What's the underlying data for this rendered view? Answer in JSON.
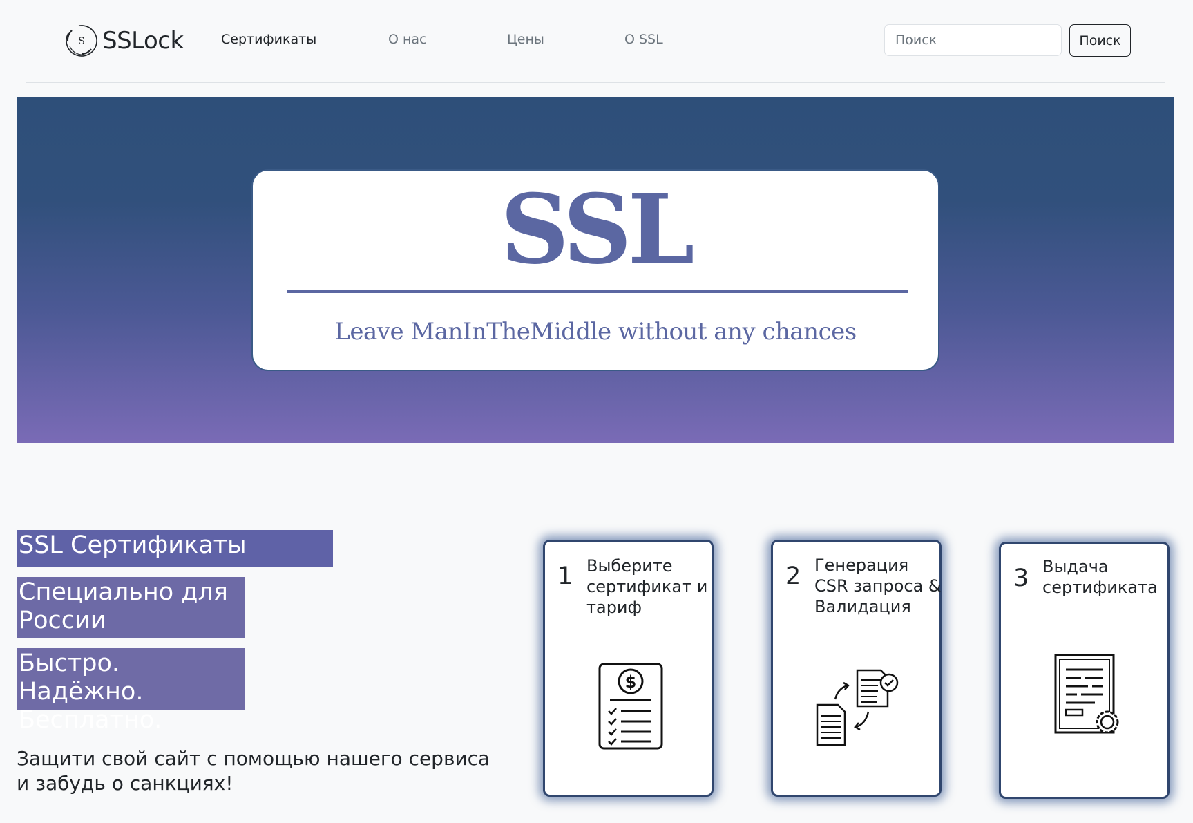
{
  "brand": {
    "logo_letter": "S",
    "name": "SSLock"
  },
  "nav": {
    "items": [
      {
        "label": "Сертификаты",
        "active": true
      },
      {
        "label": "О нас"
      },
      {
        "label": "Цены"
      },
      {
        "label": "О SSL"
      }
    ],
    "search_placeholder": "Поиск",
    "search_button": "Поиск"
  },
  "hero": {
    "title": "SSL",
    "tagline": "Leave ManInTheMiddle without any chances",
    "gradient_colors": [
      "#2e4f79",
      "#4c5995",
      "#7a6bb6"
    ]
  },
  "intro": {
    "badges": [
      "SSL Сертификаты",
      "Специально для России",
      "Быстро. Надёжно. Бесплатно."
    ],
    "lead": "Защити свой сайт с помощью нашего сервиса и забудь о санкциях!"
  },
  "steps": [
    {
      "number": "1",
      "label": "Выберите сертификат и тариф",
      "icon": "price-list-icon"
    },
    {
      "number": "2",
      "label": "Генерация CSR запроса & Валидация",
      "icon": "document-exchange-icon"
    },
    {
      "number": "3",
      "label": "Выдача сертификата",
      "icon": "certificate-icon"
    }
  ],
  "colors": {
    "accent": "#5f62a7",
    "accent_muted": "#6d6aa6",
    "card_border": "#30466e",
    "hero_text": "#5b67a2"
  }
}
